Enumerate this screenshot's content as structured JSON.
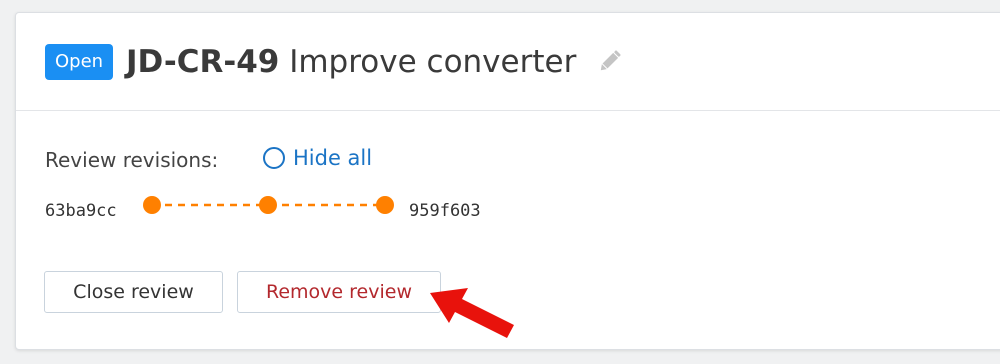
{
  "header": {
    "status_badge": "Open",
    "issue_key": "JD-CR-49",
    "title": "Improve converter",
    "edit_icon": "pencil-icon"
  },
  "revisions": {
    "label": "Review revisions:",
    "hide_all": "Hide all",
    "from_hash": "63ba9cc",
    "to_hash": "959f603",
    "node_count": 3,
    "color": "#ff8000"
  },
  "actions": {
    "close_label": "Close review",
    "remove_label": "Remove review"
  },
  "colors": {
    "badge_bg": "#1a8ff3",
    "link": "#1b74c5",
    "danger_text": "#b3282d",
    "arrow": "#e8120c"
  }
}
